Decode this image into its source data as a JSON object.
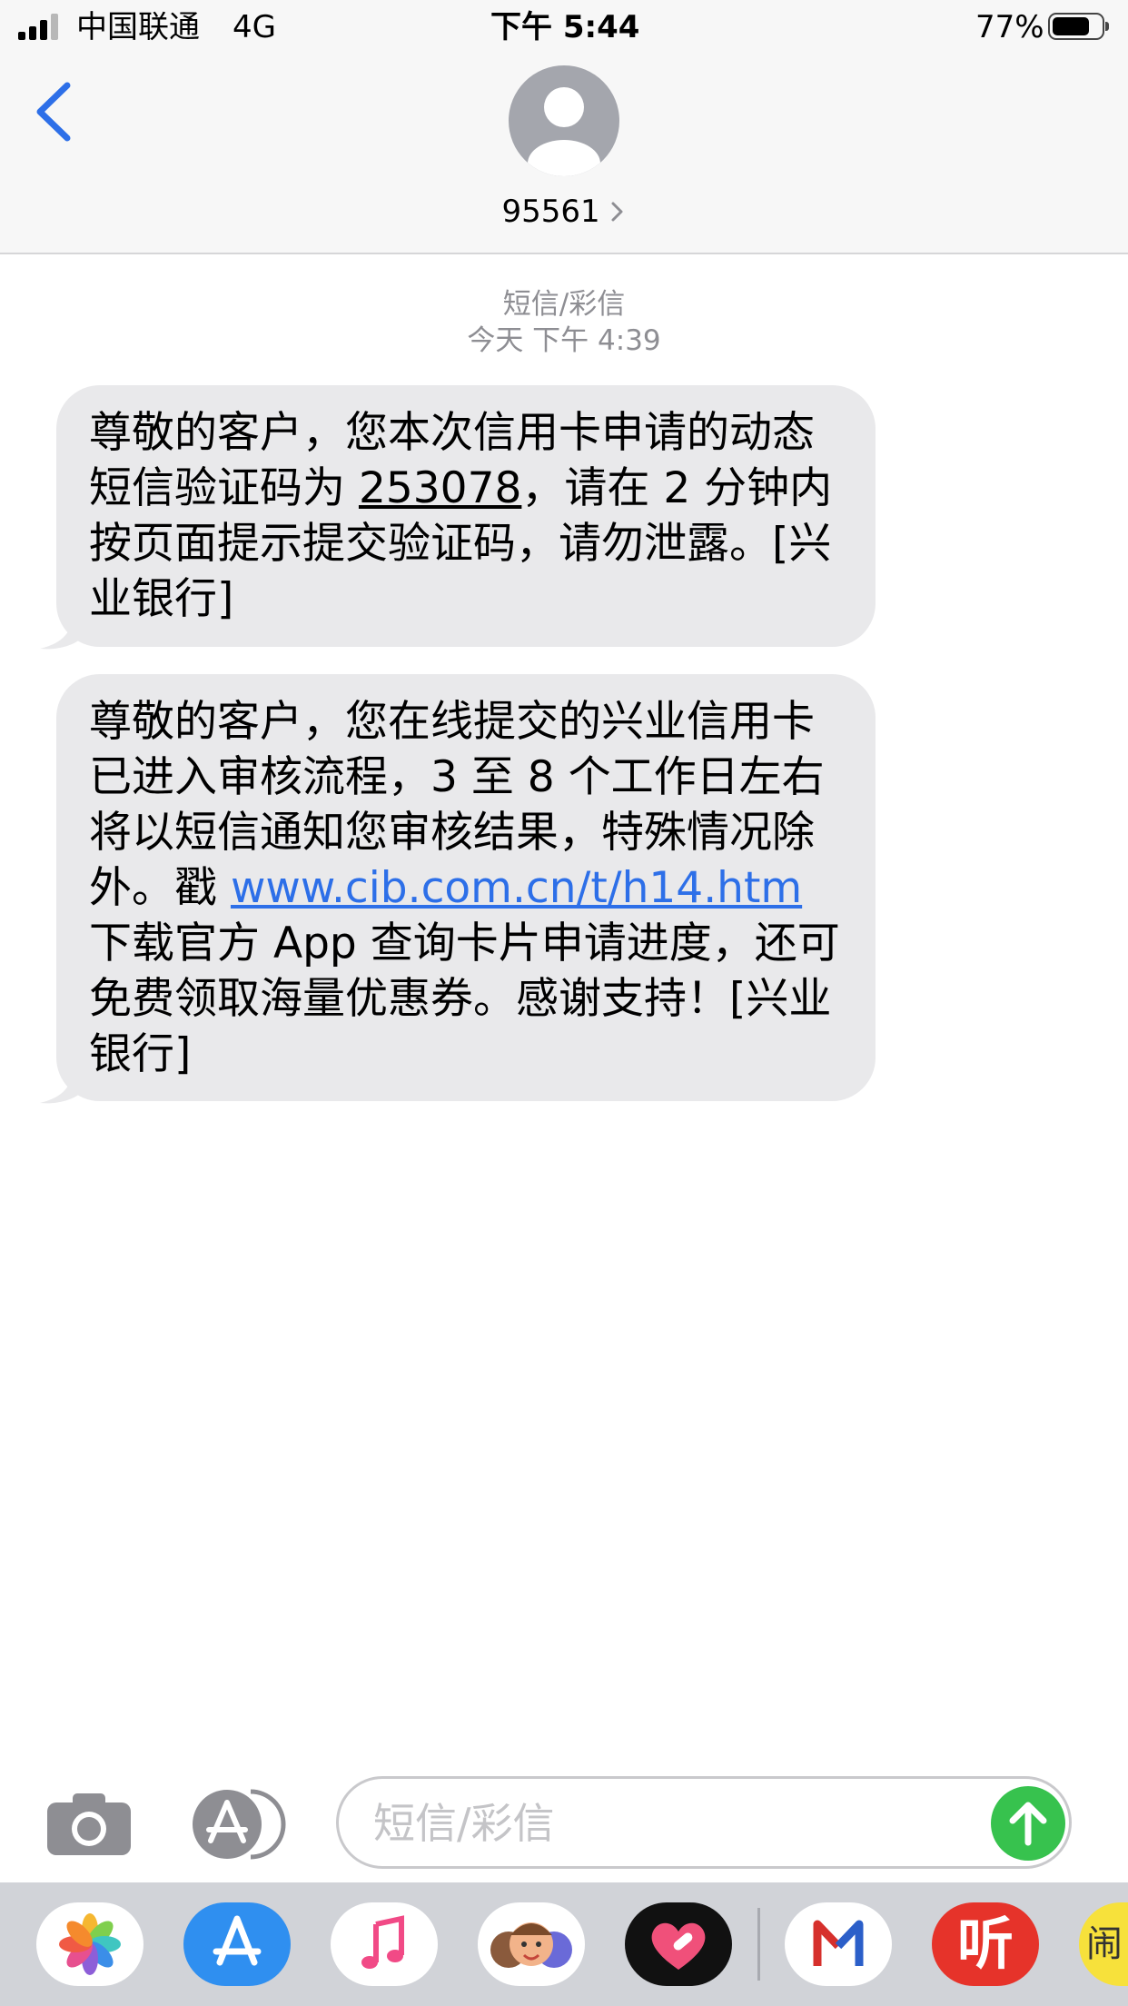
{
  "status_bar": {
    "carrier": "中国联通",
    "network": "4G",
    "time": "下午 5:44",
    "battery": "77%",
    "battery_level": 0.77
  },
  "header": {
    "back_icon": "chevron-left-icon",
    "contact_name": "95561",
    "avatar_icon": "person-avatar-icon"
  },
  "thread": {
    "service_label": "短信/彩信",
    "timestamp": "今天 下午 4:39"
  },
  "messages": [
    {
      "parts": {
        "a": "尊敬的客户，您本次信用卡申请的动态短信验证码为 ",
        "code": "253078",
        "b": "，请在 2 分钟内按页面提示提交验证码，请勿泄露。[兴业银行]"
      }
    },
    {
      "parts": {
        "a": "尊敬的客户，您在线提交的兴业信用卡已进入审核流程，3 至 8 个工作日左右将以短信通知您审核结果，特殊情况除外。戳 ",
        "link": "www.cib.com.cn/t/h14.htm",
        "b": " 下载官方 App 查询卡片申请进度，还可免费领取海量优惠券。感谢支持！[兴业银行]"
      }
    }
  ],
  "composer": {
    "placeholder": "短信/彩信",
    "camera_icon": "camera-icon",
    "apps_icon": "app-store-icon",
    "send_icon": "send-arrow-up-icon"
  },
  "dock": {
    "apps": [
      "photos-icon",
      "app-store-icon",
      "music-icon",
      "memoji-icon",
      "heart-app-icon",
      "mail-m-app-icon",
      "ting-app-icon",
      "partial-app-icon"
    ],
    "ting_label": "听",
    "partial_label": "闹"
  },
  "colors": {
    "accent": "#2d6fe8",
    "bubble": "#e9e9eb",
    "send": "#37c24e"
  }
}
